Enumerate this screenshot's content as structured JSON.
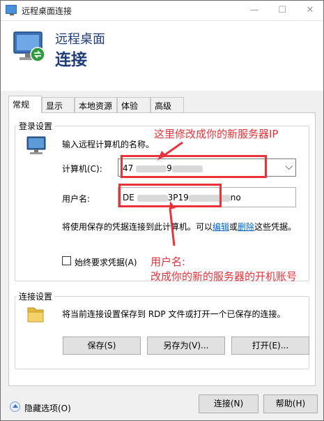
{
  "window": {
    "title": "远程桌面连接",
    "minimize": "—",
    "maximize": "☐",
    "close": "✕"
  },
  "header": {
    "line1": "远程桌面",
    "line2": "连接"
  },
  "tabs": [
    {
      "label": "常规",
      "active": true
    },
    {
      "label": "显示",
      "active": false
    },
    {
      "label": "本地资源",
      "active": false
    },
    {
      "label": "体验",
      "active": false
    },
    {
      "label": "高级",
      "active": false
    }
  ],
  "login": {
    "group_title": "登录设置",
    "instruction": "输入远程计算机的名称。",
    "computer_label": "计算机(C):",
    "computer_value_prefix": "47",
    "computer_value_mid": "9",
    "username_label": "用户名:",
    "username_value_prefix": "DE",
    "username_value_mid": "3P19",
    "username_value_suffix": "no",
    "cred_text_before": "将使用保存的凭据连接到此计算机。可以",
    "cred_edit_link": "编辑",
    "cred_or": "或",
    "cred_delete_link": "删除",
    "cred_text_after": "这些凭据。",
    "always_ask_label": "始终要求凭据(A)",
    "always_ask_checked": false
  },
  "connection": {
    "group_title": "连接设置",
    "description": "将当前连接设置保存到 RDP 文件或打开一个已保存的连接。",
    "save_button": "保存(S)",
    "saveas_button": "另存为(V)...",
    "open_button": "打开(E)..."
  },
  "footer": {
    "hide_options": "隐藏选项(O)",
    "connect_button": "连接(N)",
    "help_button": "帮助(H)"
  },
  "annotations": {
    "server_ip_note": "这里修改成你的新服务器IP",
    "username_note_line1": "用户名:",
    "username_note_line2": "改成你的新的服务器的开机账号",
    "color": "#e8333a"
  }
}
